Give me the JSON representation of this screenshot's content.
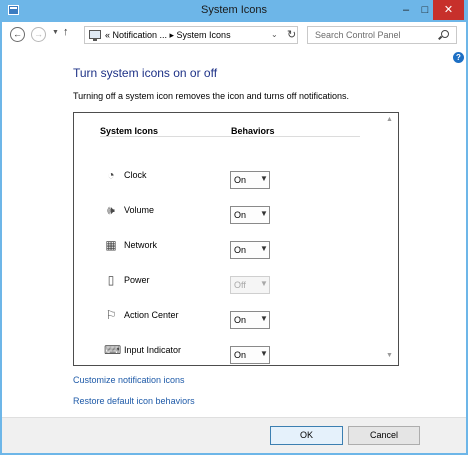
{
  "window": {
    "title": "System Icons",
    "controls": {
      "minimize": "–",
      "maximize": "□",
      "close": "✕"
    }
  },
  "nav": {
    "back_icon": "back-arrow-icon",
    "forward_icon": "forward-arrow-icon",
    "address_path": "«  Notification ...  ▸  System Icons",
    "search_placeholder": "Search Control Panel"
  },
  "page": {
    "heading": "Turn system icons on or off",
    "description": "Turning off a system icon removes the icon and turns off notifications."
  },
  "table": {
    "col_icons": "System Icons",
    "col_behaviors": "Behaviors",
    "rows": [
      {
        "label": "Clock",
        "icon": "clock-icon",
        "value": "On",
        "enabled": true
      },
      {
        "label": "Volume",
        "icon": "volume-icon",
        "value": "On",
        "enabled": true
      },
      {
        "label": "Network",
        "icon": "network-icon",
        "value": "On",
        "enabled": true
      },
      {
        "label": "Power",
        "icon": "power-icon",
        "value": "Off",
        "enabled": false
      },
      {
        "label": "Action Center",
        "icon": "action-center-flag-icon",
        "value": "On",
        "enabled": true
      },
      {
        "label": "Input Indicator",
        "icon": "keyboard-icon",
        "value": "On",
        "enabled": true
      }
    ]
  },
  "links": {
    "customize": "Customize notification icons",
    "restore": "Restore default icon behaviors"
  },
  "buttons": {
    "ok": "OK",
    "cancel": "Cancel"
  },
  "colors": {
    "titlebar": "#6db6e8",
    "close": "#c7302b",
    "heading": "#1e3287",
    "link": "#1e5aa8"
  }
}
